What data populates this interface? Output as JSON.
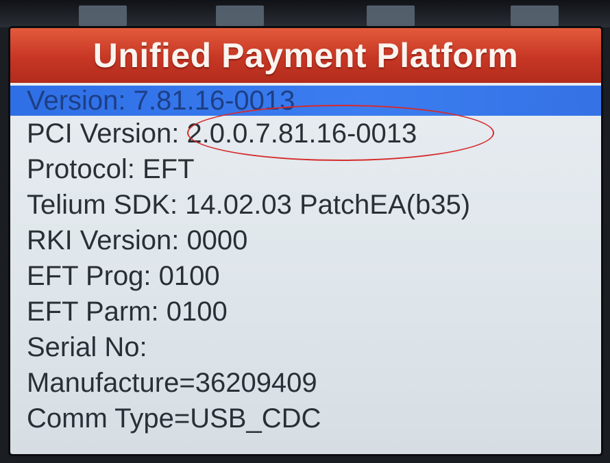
{
  "screen": {
    "title": "Unified Payment Platform",
    "accent_color": "#c73624",
    "selection_color": "#3b7df0",
    "annotation": {
      "shape": "ellipse",
      "color": "#d62a2a"
    },
    "items": [
      {
        "label": "Version: 7.81.16-0013",
        "selected": true
      },
      {
        "label": "PCI Version: 2.0.0.7.81.16-0013",
        "selected": false
      },
      {
        "label": "Protocol: EFT",
        "selected": false
      },
      {
        "label": "Telium SDK: 14.02.03 PatchEA(b35)",
        "selected": false
      },
      {
        "label": "RKI Version: 0000",
        "selected": false
      },
      {
        "label": "EFT Prog: 0100",
        "selected": false
      },
      {
        "label": "EFT Parm: 0100",
        "selected": false
      },
      {
        "label": "Serial No:",
        "selected": false
      },
      {
        "label": "Manufacture=36209409",
        "selected": false
      },
      {
        "label": "Comm Type=USB_CDC",
        "selected": false
      }
    ]
  }
}
